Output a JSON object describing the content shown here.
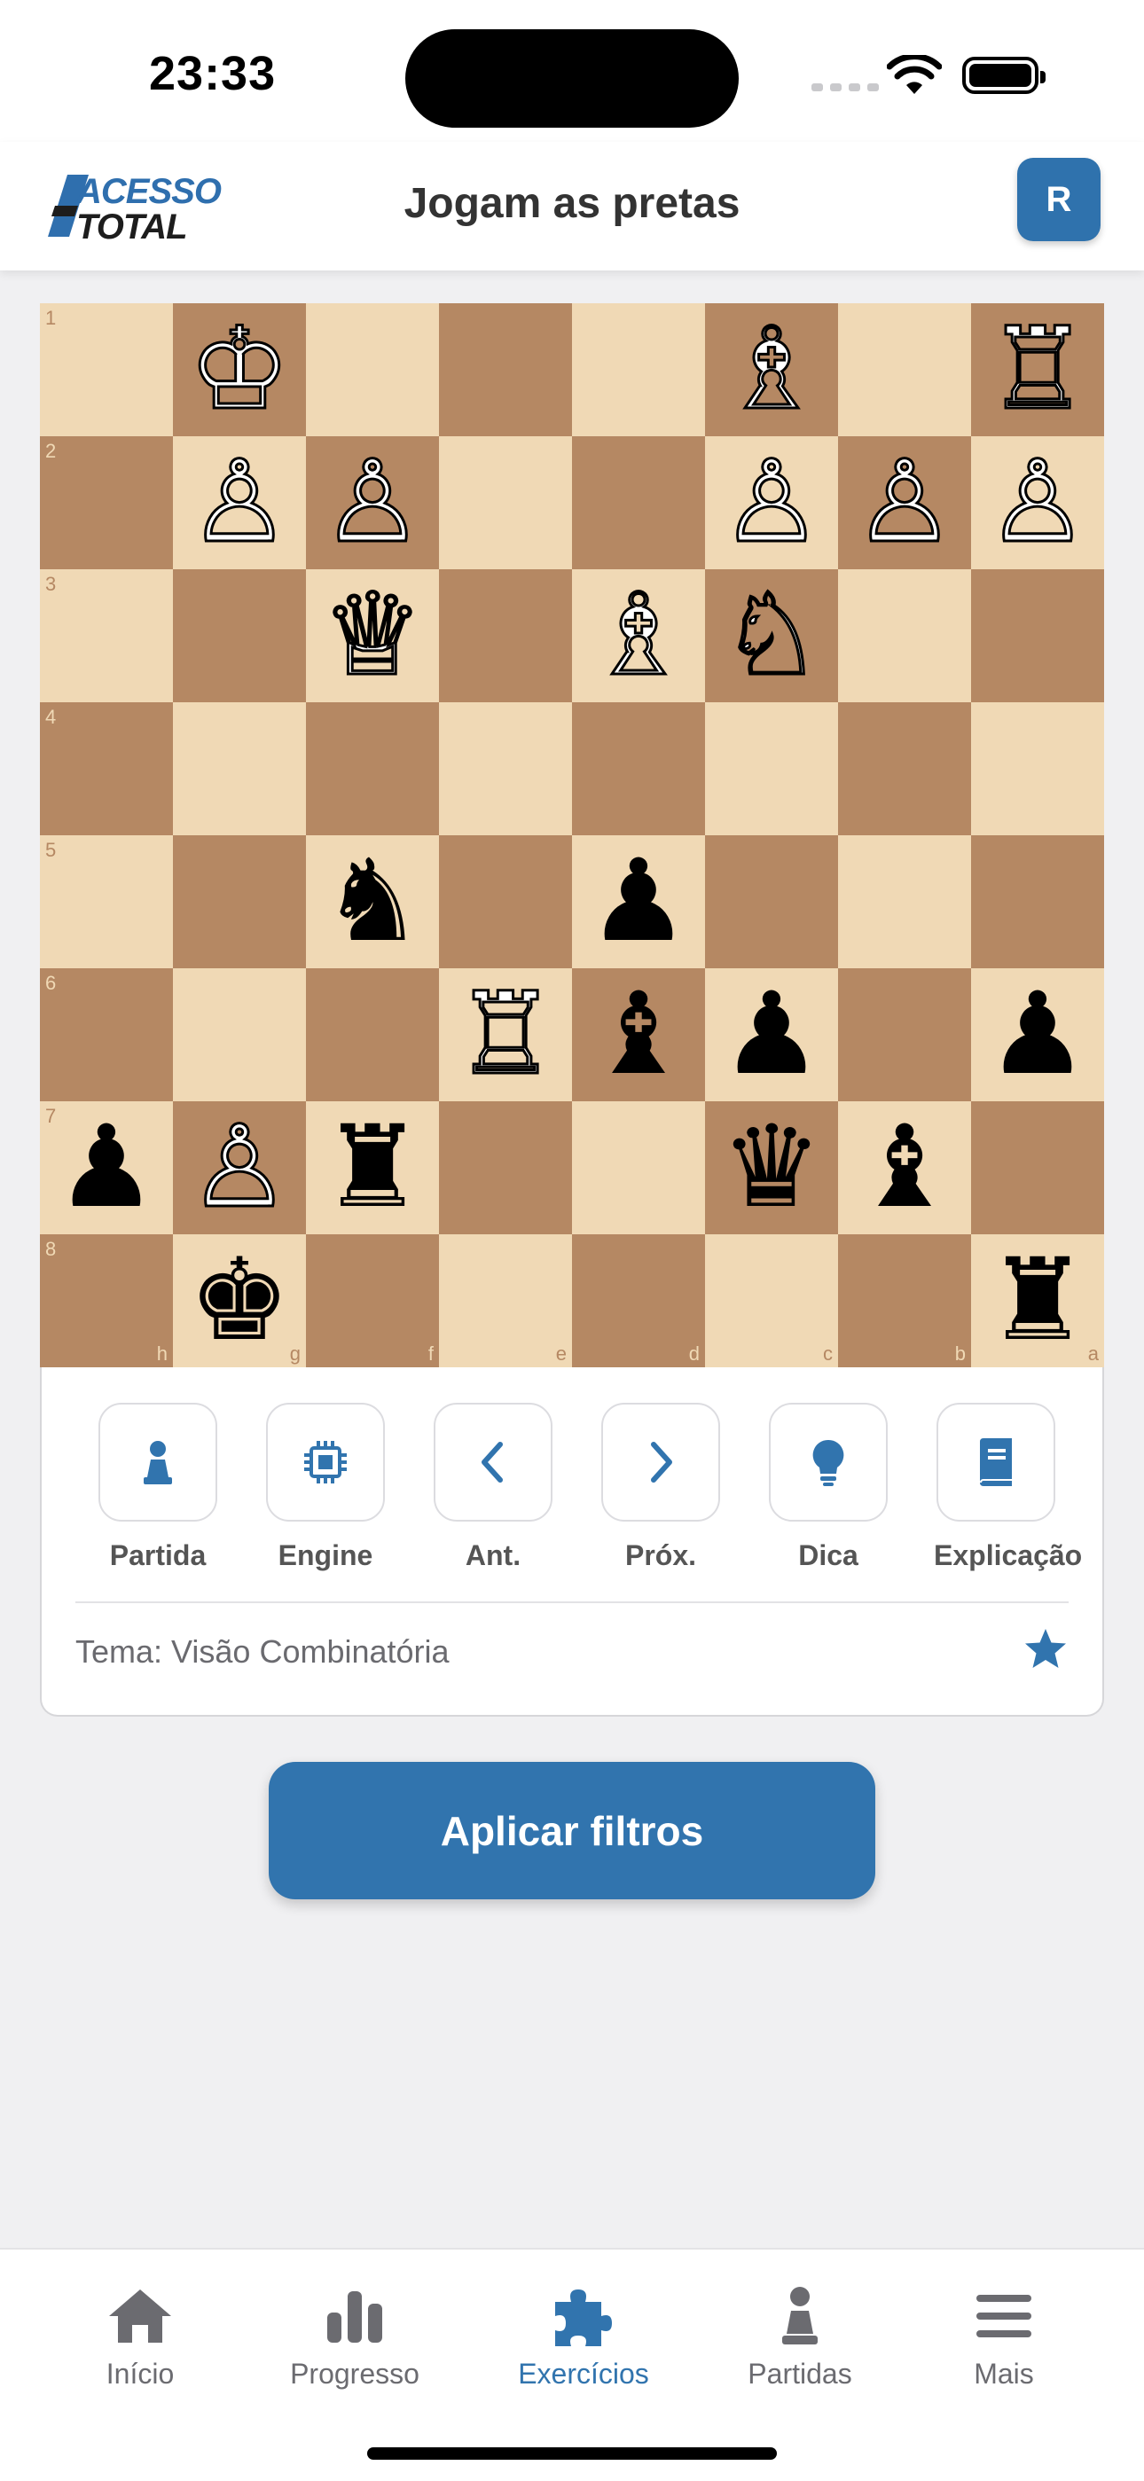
{
  "status_bar": {
    "time": "23:33"
  },
  "header": {
    "logo_line1": "ACESSO",
    "logo_line2": "TOTAL",
    "title": "Jogam as pretas",
    "avatar_initial": "R"
  },
  "board": {
    "ranks": [
      "1",
      "2",
      "3",
      "4",
      "5",
      "6",
      "7",
      "8"
    ],
    "files": [
      "h",
      "g",
      "f",
      "e",
      "d",
      "c",
      "b",
      "a"
    ],
    "rows": [
      [
        "",
        "♔",
        "",
        "",
        "",
        "♗",
        "",
        "♖"
      ],
      [
        "",
        "♙",
        "♙",
        "",
        "",
        "♙",
        "♙",
        "♙"
      ],
      [
        "",
        "",
        "♕",
        "",
        "♗",
        "♘",
        "",
        ""
      ],
      [
        "",
        "",
        "",
        "",
        "",
        "",
        "",
        ""
      ],
      [
        "",
        "",
        "♞",
        "",
        "♟",
        "",
        "",
        ""
      ],
      [
        "",
        "",
        "",
        "♖",
        "♝",
        "♟",
        "",
        "♟"
      ],
      [
        "♟",
        "♙",
        "♜",
        "",
        "",
        "♛",
        "♝",
        ""
      ],
      [
        "",
        "♚",
        "",
        "",
        "",
        "",
        "",
        "♜"
      ]
    ]
  },
  "controls": [
    {
      "label": "Partida",
      "icon": "pawn-icon"
    },
    {
      "label": "Engine",
      "icon": "chip-icon"
    },
    {
      "label": "Ant.",
      "icon": "chevron-left-icon"
    },
    {
      "label": "Próx.",
      "icon": "chevron-right-icon"
    },
    {
      "label": "Dica",
      "icon": "lightbulb-icon"
    },
    {
      "label": "Explicação",
      "icon": "book-icon"
    }
  ],
  "theme_text": "Tema: Visão Combinatória",
  "apply_button": "Aplicar filtros",
  "tabs": [
    {
      "label": "Início",
      "icon": "home-icon",
      "active": false
    },
    {
      "label": "Progresso",
      "icon": "bar-chart-icon",
      "active": false
    },
    {
      "label": "Exercícios",
      "icon": "puzzle-icon",
      "active": true
    },
    {
      "label": "Partidas",
      "icon": "pawn-icon",
      "active": false
    },
    {
      "label": "Mais",
      "icon": "menu-icon",
      "active": false
    }
  ],
  "colors": {
    "accent": "#3174ae",
    "board_light": "#f0d9b5",
    "board_dark": "#b58863"
  }
}
